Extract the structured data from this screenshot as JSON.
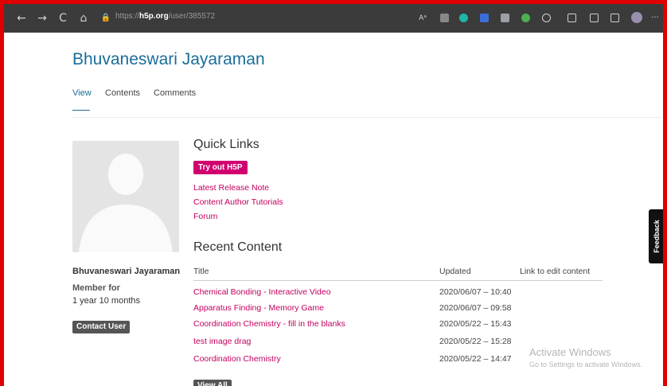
{
  "browser": {
    "url_prefix": "https://",
    "url_domain": "h5p.org",
    "url_path": "/user/385572",
    "back_glyph": "←",
    "forward_glyph": "→",
    "reload_glyph": "C",
    "home_glyph": "⌂",
    "lock_glyph": "🔒",
    "read_aloud_label": "Aᵃ",
    "more_glyph": "···",
    "icon_colors": [
      "#888888",
      "#1fb5a8",
      "#3b6fd8",
      "#9aa0a6",
      "#4caf50",
      "#cfcfcf",
      "#cfcfcf",
      "#cfcfcf",
      "#cfcfcf"
    ]
  },
  "profile": {
    "name": "Bhuvaneswari Jayaraman",
    "member_for_label": "Member for",
    "member_for_value": "1 year 10 months",
    "contact_button": "Contact User"
  },
  "tabs": [
    {
      "label": "View",
      "active": true
    },
    {
      "label": "Contents",
      "active": false
    },
    {
      "label": "Comments",
      "active": false
    }
  ],
  "quick_links": {
    "title": "Quick Links",
    "try_button": "Try out H5P",
    "links": [
      "Latest Release Note",
      "Content Author Tutorials",
      "Forum"
    ]
  },
  "recent_content": {
    "title": "Recent Content",
    "headers": {
      "title": "Title",
      "updated": "Updated",
      "link": "Link to edit content"
    },
    "rows": [
      {
        "title": "Chemical Bonding - Interactive Video",
        "updated": "2020/06/07 – 10:40"
      },
      {
        "title": "Apparatus Finding - Memory Game",
        "updated": "2020/06/07 – 09:58"
      },
      {
        "title": "Coordination Chemistry - fill in the blanks",
        "updated": "2020/05/22 – 15:43"
      },
      {
        "title": "test image drag",
        "updated": "2020/05/22 – 15:28"
      },
      {
        "title": "Coordination Chemistry",
        "updated": "2020/05/22 – 14:47"
      }
    ],
    "view_all_button": "View All"
  },
  "feedback_tab": "Feedback",
  "watermark": {
    "title": "Activate Windows",
    "subtitle": "Go to Settings to activate Windows."
  },
  "colors": {
    "accent": "#1a6d98",
    "link": "#c2005f",
    "brand_button": "#d1006f",
    "screen_border": "#e00000"
  }
}
